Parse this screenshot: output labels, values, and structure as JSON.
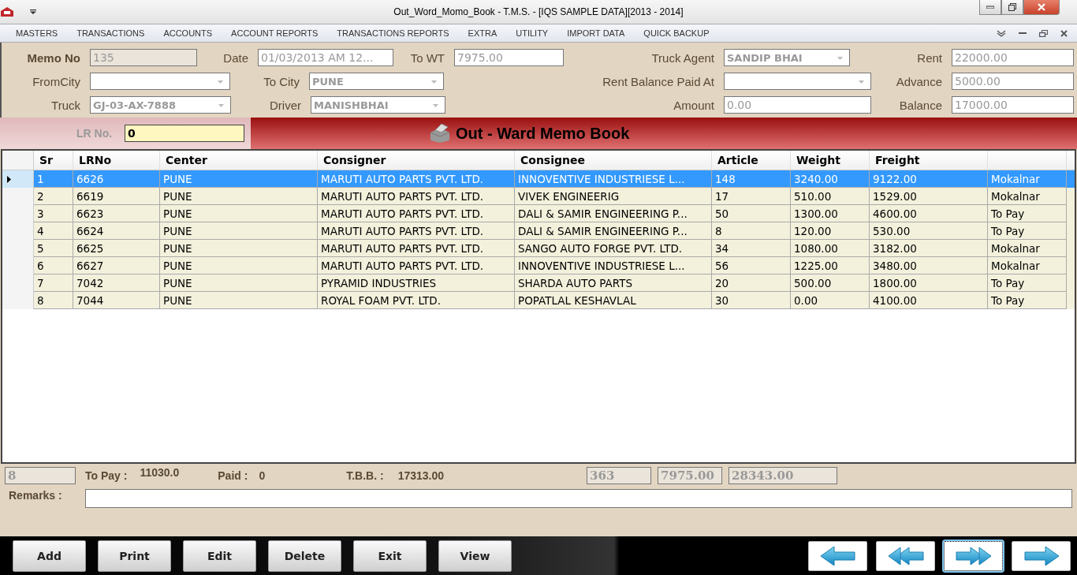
{
  "window": {
    "title": "Out_Word_Momo_Book - T.M.S. - [IQS SAMPLE DATA][2013 - 2014]"
  },
  "menu": [
    "MASTERS",
    "TRANSACTIONS",
    "ACCOUNTS",
    "ACCOUNT REPORTS",
    "TRANSACTIONS REPORTS",
    "EXTRA",
    "UTILITY",
    "IMPORT DATA",
    "QUICK BACKUP"
  ],
  "form": [
    [
      {
        "label": "Memo No",
        "value": "135",
        "kind": "text",
        "disabled": true
      },
      {
        "label": "Date",
        "value": "01/03/2013 AM 12...",
        "kind": "text",
        "disabled": false
      },
      {
        "label": "To WT",
        "value": "7975.00",
        "kind": "text",
        "disabled": false
      },
      {
        "label": "Truck Agent",
        "value": "SANDIP BHAI",
        "kind": "combo",
        "disabled": false
      },
      {
        "label": "Rent",
        "value": "22000.00",
        "kind": "text",
        "disabled": false
      }
    ],
    [
      {
        "label": "FromCity",
        "kind": "combo",
        "disabled": false
      },
      {
        "label": "To City",
        "value": "PUNE",
        "kind": "combo",
        "disabled": false
      },
      {
        "label": "Rent Balance Paid At",
        "kind": "combo",
        "disabled": false
      },
      {
        "label": "Advance",
        "value": "5000.00",
        "kind": "text",
        "disabled": false
      }
    ],
    [
      {
        "label": "Truck",
        "value": "GJ-03-AX-7888",
        "kind": "combo",
        "disabled": false
      },
      {
        "label": "Driver",
        "value": "MANISHBHAI",
        "kind": "combo",
        "disabled": false
      },
      {
        "label": "Amount",
        "value": "0.00",
        "kind": "text",
        "disabled": false
      },
      {
        "label": "Balance",
        "value": "17000.00",
        "kind": "text",
        "disabled": false
      }
    ]
  ],
  "lr": {
    "label": "LR No.",
    "value": "0"
  },
  "banner": {
    "title": "Out - Ward Memo Book"
  },
  "table": {
    "columns": [
      "Sr",
      "LRNo",
      "Center",
      "Consigner",
      "Consignee",
      "Article",
      "Weight",
      "Freight"
    ],
    "rows": [
      {
        "selected": true,
        "cells": [
          "1",
          "6626",
          "PUNE",
          "MARUTI AUTO PARTS PVT. LTD.",
          "INNOVENTIVE INDUSTRIESE L...",
          "148",
          "3240.00",
          "9122.00",
          "Mokalnar"
        ]
      },
      {
        "selected": false,
        "cells": [
          "2",
          "6619",
          "PUNE",
          "MARUTI AUTO PARTS PVT. LTD.",
          "VIVEK ENGINEERIG",
          "17",
          "510.00",
          "1529.00",
          "Mokalnar"
        ]
      },
      {
        "selected": false,
        "cells": [
          "3",
          "6623",
          "PUNE",
          "MARUTI AUTO PARTS PVT. LTD.",
          "DALI & SAMIR ENGINEERING P...",
          "50",
          "1300.00",
          "4600.00",
          "To Pay"
        ]
      },
      {
        "selected": false,
        "cells": [
          "4",
          "6624",
          "PUNE",
          "MARUTI AUTO PARTS PVT. LTD.",
          "DALI & SAMIR ENGINEERING P...",
          "8",
          "120.00",
          "530.00",
          "To Pay"
        ]
      },
      {
        "selected": false,
        "cells": [
          "5",
          "6625",
          "PUNE",
          "MARUTI AUTO PARTS PVT. LTD.",
          "SANGO AUTO FORGE PVT. LTD.",
          "34",
          "1080.00",
          "3182.00",
          "Mokalnar"
        ]
      },
      {
        "selected": false,
        "cells": [
          "6",
          "6627",
          "PUNE",
          "MARUTI AUTO PARTS PVT. LTD.",
          "INNOVENTIVE INDUSTRIESE L...",
          "56",
          "1225.00",
          "3480.00",
          "Mokalnar"
        ]
      },
      {
        "selected": false,
        "cells": [
          "7",
          "7042",
          "PUNE",
          "PYRAMID INDUSTRIES",
          "SHARDA AUTO PARTS",
          "20",
          "500.00",
          "1800.00",
          "To Pay"
        ]
      },
      {
        "selected": false,
        "cells": [
          "8",
          "7044",
          "PUNE",
          "ROYAL FOAM PVT. LTD.",
          "POPATLAL KESHAVLAL",
          "30",
          "0.00",
          "4100.00",
          "To Pay"
        ]
      }
    ]
  },
  "totals": {
    "count": "8",
    "to_pay_label": "To Pay :",
    "to_pay": "11030.0",
    "paid_label": "Paid :",
    "paid": "0",
    "tbb_label": "T.B.B. :",
    "tbb": "17313.00",
    "article_total": "363",
    "weight_total": "7975.00",
    "freight_total": "28343.00"
  },
  "remarks": {
    "label": "Remarks :"
  },
  "buttons": [
    "Add",
    "Print",
    "Edit",
    "Delete",
    "Exit",
    "View"
  ],
  "nav_buttons": [
    {
      "kind": "prev",
      "focused": false
    },
    {
      "kind": "first",
      "focused": false
    },
    {
      "kind": "last",
      "focused": true
    },
    {
      "kind": "next",
      "focused": false
    }
  ]
}
